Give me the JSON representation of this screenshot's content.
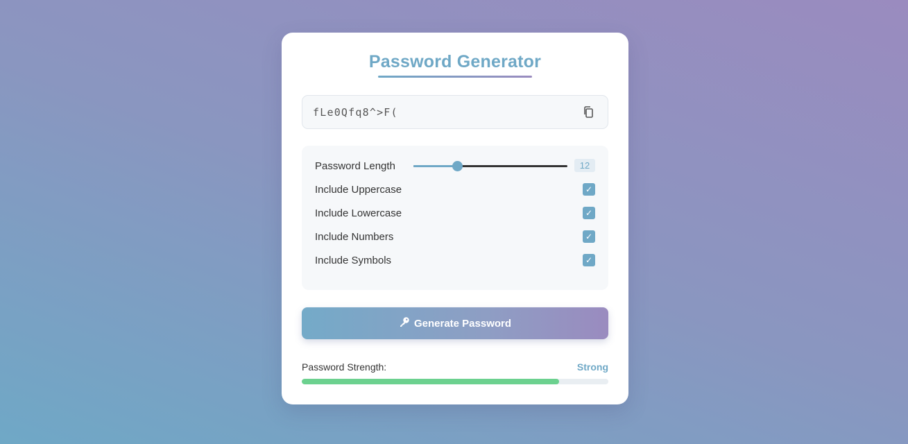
{
  "title": "Password Generator",
  "password": {
    "value": "fLe0Qfq8^>F("
  },
  "options": {
    "length_label": "Password Length",
    "length_value": "12",
    "length_min": 4,
    "length_max": 32,
    "uppercase_label": "Include Uppercase",
    "lowercase_label": "Include Lowercase",
    "numbers_label": "Include Numbers",
    "symbols_label": "Include Symbols",
    "uppercase_checked": true,
    "lowercase_checked": true,
    "numbers_checked": true,
    "symbols_checked": true,
    "check_glyph": "✓"
  },
  "generate_button": {
    "label": "Generate Password",
    "icon": "key-icon"
  },
  "strength": {
    "label": "Password Strength:",
    "value": "Strong",
    "fraction": 0.84
  },
  "colors": {
    "accent": "#6fa8c6",
    "accent2": "#9a8bbf",
    "strength_good": "#6cd18f"
  }
}
